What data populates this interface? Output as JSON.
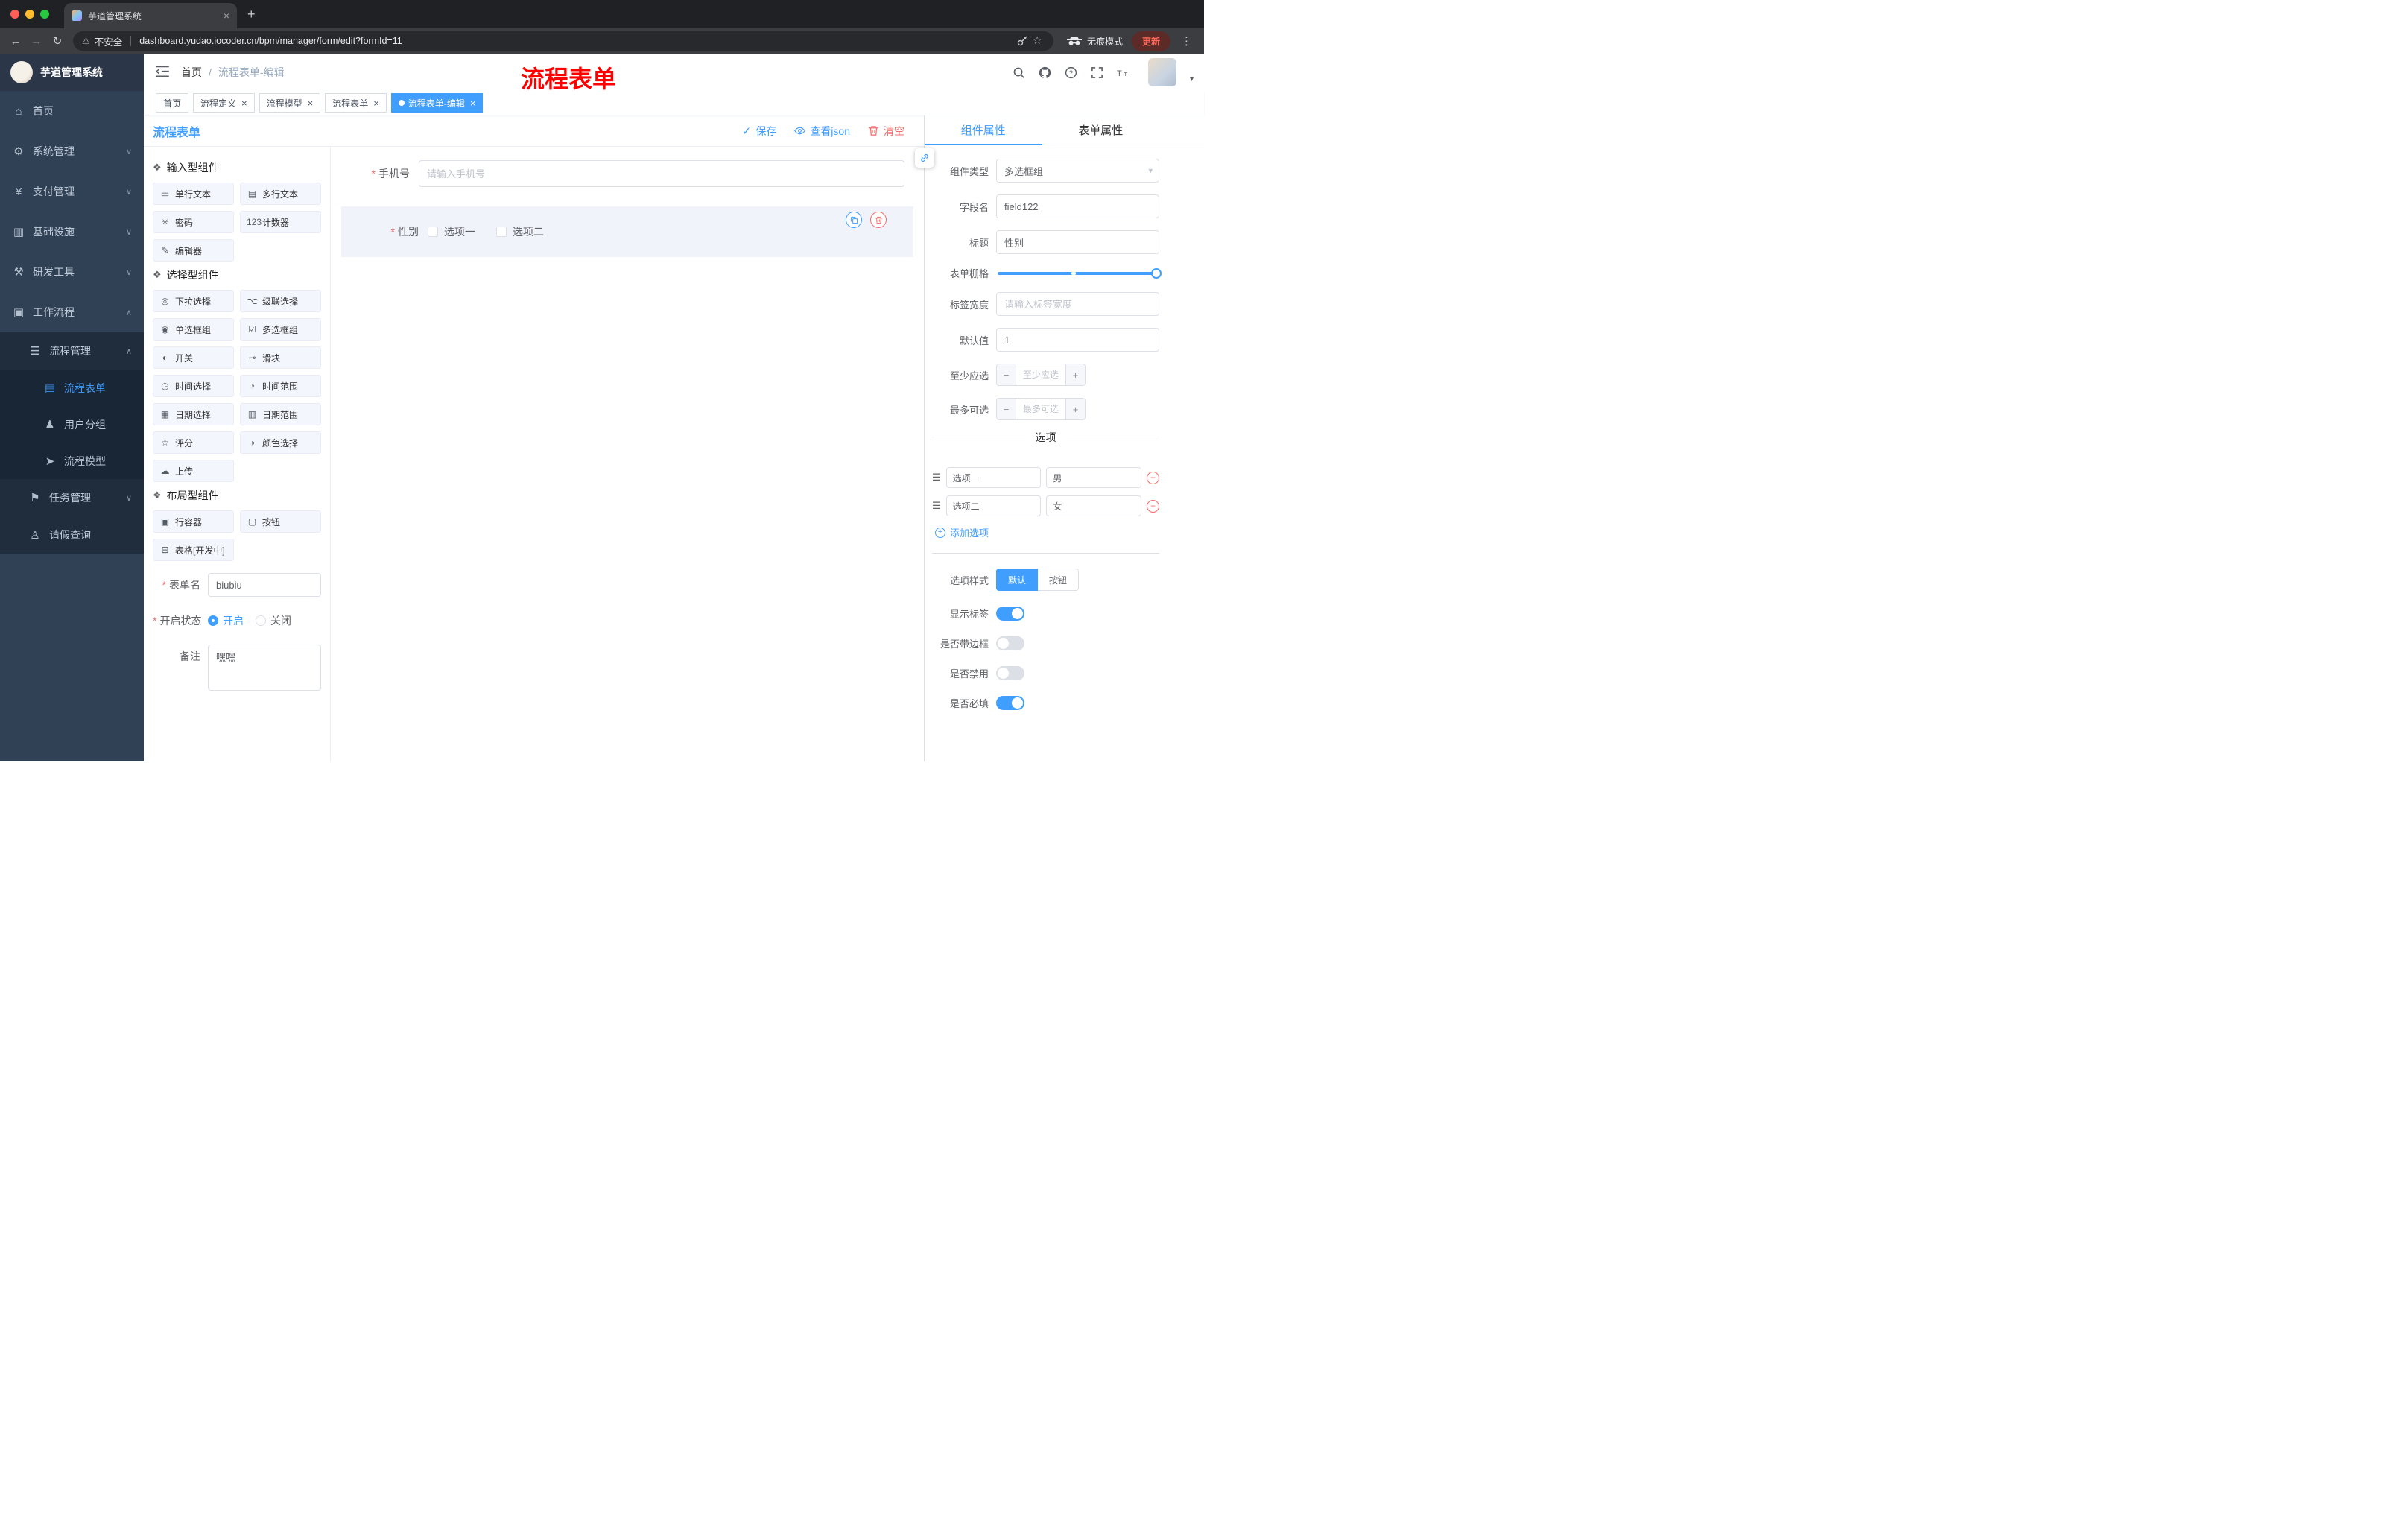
{
  "browser": {
    "tab_title": "芋道管理系统",
    "security_label": "不安全",
    "url": "dashboard.yudao.iocoder.cn/bpm/manager/form/edit?formId=11",
    "incognito_label": "无痕模式",
    "update_label": "更新"
  },
  "sidebar": {
    "logo_title": "芋道管理系统",
    "items": [
      {
        "id": "home",
        "icon": "home-icon",
        "label": "首页",
        "level": 0
      },
      {
        "id": "system-management",
        "icon": "gear-icon",
        "label": "系统管理",
        "level": 0,
        "chevron": "down"
      },
      {
        "id": "payment-management",
        "icon": "yen-icon",
        "label": "支付管理",
        "level": 0,
        "chevron": "down"
      },
      {
        "id": "infrastructure",
        "icon": "monitor-icon",
        "label": "基础设施",
        "level": 0,
        "chevron": "down"
      },
      {
        "id": "dev-tools",
        "icon": "tools-icon",
        "label": "研发工具",
        "level": 0,
        "chevron": "down"
      },
      {
        "id": "workflow",
        "icon": "workflow-icon",
        "label": "工作流程",
        "level": 0,
        "chevron": "up"
      },
      {
        "id": "process-management",
        "icon": "list-icon",
        "label": "流程管理",
        "level": 1,
        "chevron": "up"
      },
      {
        "id": "process-form",
        "icon": "document-icon",
        "label": "流程表单",
        "level": 2,
        "active": true
      },
      {
        "id": "user-group",
        "icon": "users-icon",
        "label": "用户分组",
        "level": 2
      },
      {
        "id": "process-model",
        "icon": "send-icon",
        "label": "流程模型",
        "level": 2
      },
      {
        "id": "task-management",
        "icon": "task-icon",
        "label": "任务管理",
        "level": 1,
        "chevron": "down"
      },
      {
        "id": "leave-query",
        "icon": "user-icon",
        "label": "请假查询",
        "level": 1
      }
    ]
  },
  "header": {
    "breadcrumb": [
      "首页",
      "流程表单-编辑"
    ],
    "breadcrumb_separator": "/",
    "watermark": "流程表单"
  },
  "tags": [
    {
      "label": "首页",
      "closable": false,
      "active": false
    },
    {
      "label": "流程定义",
      "closable": true,
      "active": false
    },
    {
      "label": "流程模型",
      "closable": true,
      "active": false
    },
    {
      "label": "流程表单",
      "closable": true,
      "active": false
    },
    {
      "label": "流程表单-编辑",
      "closable": true,
      "active": true
    }
  ],
  "designer": {
    "title": "流程表单",
    "actions": {
      "save": "保存",
      "view_json": "查看json",
      "clear": "清空"
    },
    "palette_groups": [
      {
        "title": "输入型组件",
        "items": [
          {
            "label": "单行文本",
            "icon": "text-input-icon"
          },
          {
            "label": "多行文本",
            "icon": "textarea-icon"
          },
          {
            "label": "密码",
            "icon": "password-icon"
          },
          {
            "label": "计数器",
            "icon": "counter-icon"
          },
          {
            "label": "编辑器",
            "icon": "editor-icon"
          }
        ]
      },
      {
        "title": "选择型组件",
        "items": [
          {
            "label": "下拉选择",
            "icon": "select-icon"
          },
          {
            "label": "级联选择",
            "icon": "cascader-icon"
          },
          {
            "label": "单选框组",
            "icon": "radio-icon"
          },
          {
            "label": "多选框组",
            "icon": "checkbox-icon"
          },
          {
            "label": "开关",
            "icon": "switch-icon"
          },
          {
            "label": "滑块",
            "icon": "slider-icon"
          },
          {
            "label": "时间选择",
            "icon": "time-icon"
          },
          {
            "label": "时间范围",
            "icon": "time-range-icon"
          },
          {
            "label": "日期选择",
            "icon": "date-icon"
          },
          {
            "label": "日期范围",
            "icon": "date-range-icon"
          },
          {
            "label": "评分",
            "icon": "rate-icon"
          },
          {
            "label": "颜色选择",
            "icon": "color-icon"
          },
          {
            "label": "上传",
            "icon": "upload-icon"
          }
        ]
      },
      {
        "title": "布局型组件",
        "items": [
          {
            "label": "行容器",
            "icon": "row-icon"
          },
          {
            "label": "按钮",
            "icon": "button-icon"
          },
          {
            "label": "表格[开发中]",
            "icon": "table-icon"
          }
        ]
      }
    ],
    "meta": {
      "name_label": "表单名",
      "name_value": "biubiu",
      "status_label": "开启状态",
      "status_options": [
        {
          "label": "开启",
          "selected": true
        },
        {
          "label": "关闭",
          "selected": false
        }
      ],
      "remark_label": "备注",
      "remark_value": "嘿嘿"
    },
    "canvas": {
      "phone_label": "手机号",
      "phone_placeholder": "请输入手机号",
      "gender_label": "性别",
      "gender_options": [
        {
          "label": "选项一",
          "checked": false
        },
        {
          "label": "选项二",
          "checked": false
        }
      ]
    }
  },
  "props": {
    "tabs": [
      {
        "id": "component-props",
        "label": "组件属性",
        "active": true
      },
      {
        "id": "form-props",
        "label": "表单属性",
        "active": false
      }
    ],
    "component_type_label": "组件类型",
    "component_type_value": "多选框组",
    "field_name_label": "字段名",
    "field_name_value": "field122",
    "title_label": "标题",
    "title_value": "性别",
    "grid_label": "表单栅格",
    "label_width_label": "标签宽度",
    "label_width_placeholder": "请输入标签宽度",
    "default_label": "默认值",
    "default_value": "1",
    "min_select_label": "至少应选",
    "min_select_placeholder": "至少应选",
    "max_select_label": "最多可选",
    "max_select_placeholder": "最多可选",
    "options_title": "选项",
    "options": [
      {
        "label": "选项一",
        "value": "男"
      },
      {
        "label": "选项二",
        "value": "女"
      }
    ],
    "add_option_label": "添加选项",
    "option_style_label": "选项样式",
    "option_styles": [
      {
        "label": "默认",
        "active": true
      },
      {
        "label": "按钮",
        "active": false
      }
    ],
    "switches": [
      {
        "id": "show-label",
        "label": "显示标签",
        "on": true
      },
      {
        "id": "with-border",
        "label": "是否带边框",
        "on": false
      },
      {
        "id": "disabled",
        "label": "是否禁用",
        "on": false
      },
      {
        "id": "required",
        "label": "是否必填",
        "on": true
      }
    ]
  },
  "colors": {
    "primary": "#409eff",
    "danger": "#f56c6c",
    "sidebar": "#304156"
  }
}
